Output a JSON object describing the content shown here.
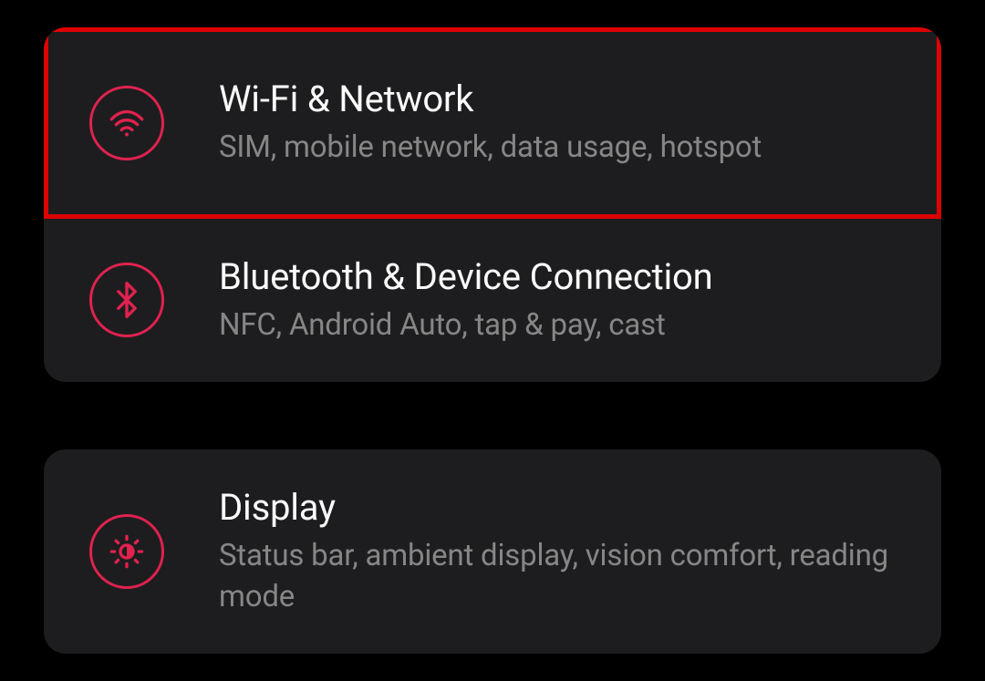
{
  "settings": {
    "groups": [
      {
        "items": [
          {
            "title": "Wi-Fi & Network",
            "subtitle": "SIM, mobile network, data usage, hotspot",
            "icon": "wifi-icon",
            "highlighted": true
          },
          {
            "title": "Bluetooth & Device Connection",
            "subtitle": "NFC, Android Auto, tap & pay, cast",
            "icon": "bluetooth-icon",
            "highlighted": false
          }
        ]
      },
      {
        "items": [
          {
            "title": "Display",
            "subtitle": "Status bar, ambient display, vision comfort, reading mode",
            "icon": "brightness-icon",
            "highlighted": false
          }
        ]
      }
    ]
  },
  "colors": {
    "accent": "#e0224e",
    "highlight_border": "#dd0202",
    "background": "#000000",
    "card": "#1d1d1f",
    "text_primary": "#fafafa",
    "text_secondary": "#868686"
  }
}
